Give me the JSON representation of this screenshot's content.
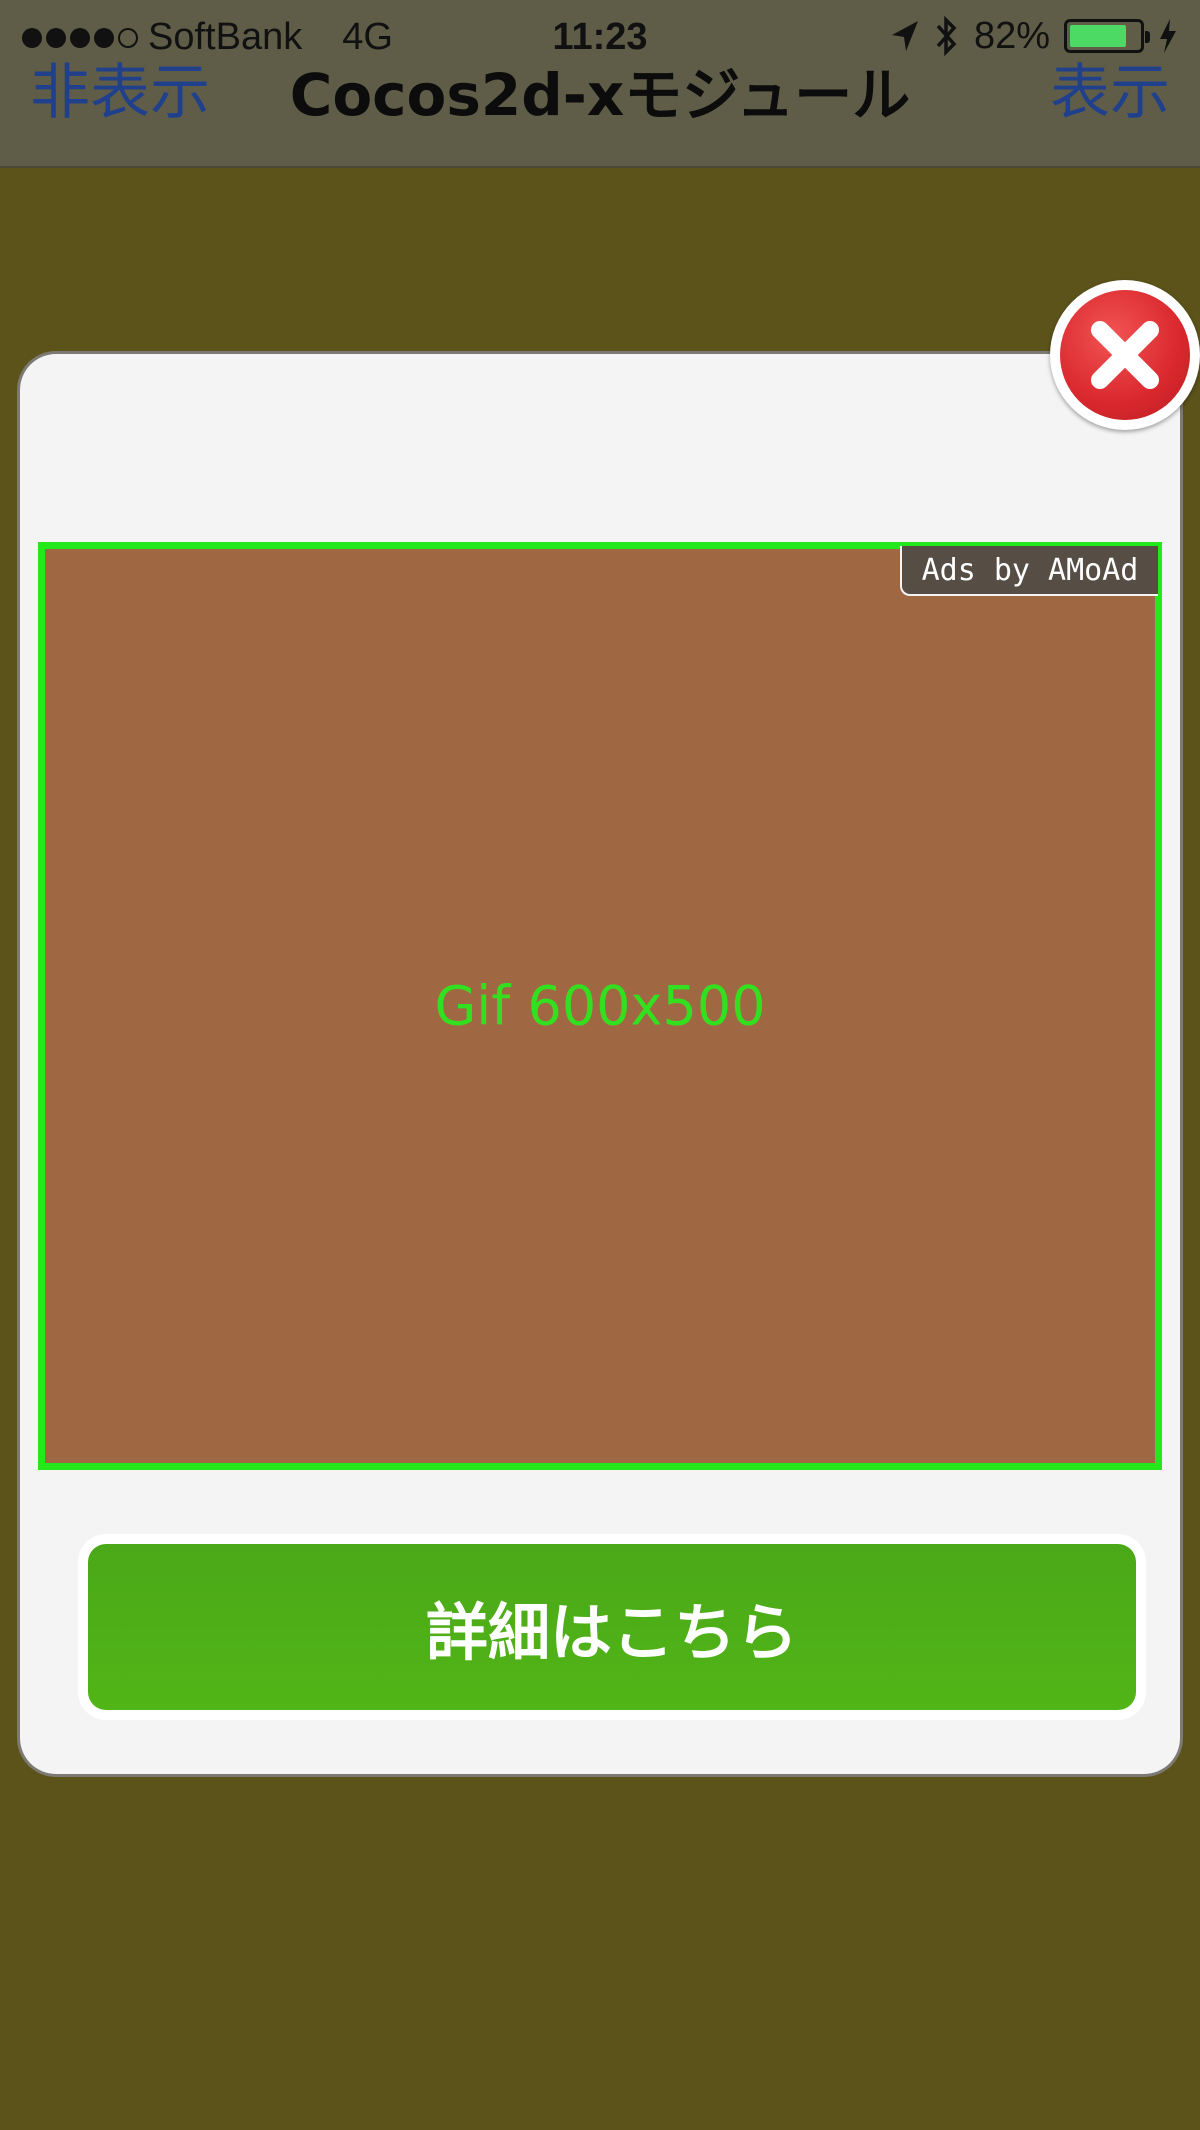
{
  "status_bar": {
    "carrier": "SoftBank",
    "network": "4G",
    "time": "11:23",
    "battery_percent": "82%",
    "battery_level": 0.82,
    "signal_bars": 4,
    "icons": [
      "location-arrow-icon",
      "bluetooth-icon",
      "charging-bolt-icon"
    ]
  },
  "navbar": {
    "left_label": "非表示",
    "title": "Cocos2d-xモジュール",
    "right_label": "表示"
  },
  "ad": {
    "placeholder_label": "Gif 600x500",
    "badge_label": "Ads by AMoAd",
    "cta_label": "詳細はこちら",
    "close_icon": "close-icon"
  },
  "colors": {
    "background": "#5c531b",
    "navbar": "#5f5d48",
    "nav_link": "#21408c",
    "ad_fill": "#a06842",
    "ad_border": "#25e81a",
    "cta": "#4fb017",
    "close": "#d9282d"
  }
}
